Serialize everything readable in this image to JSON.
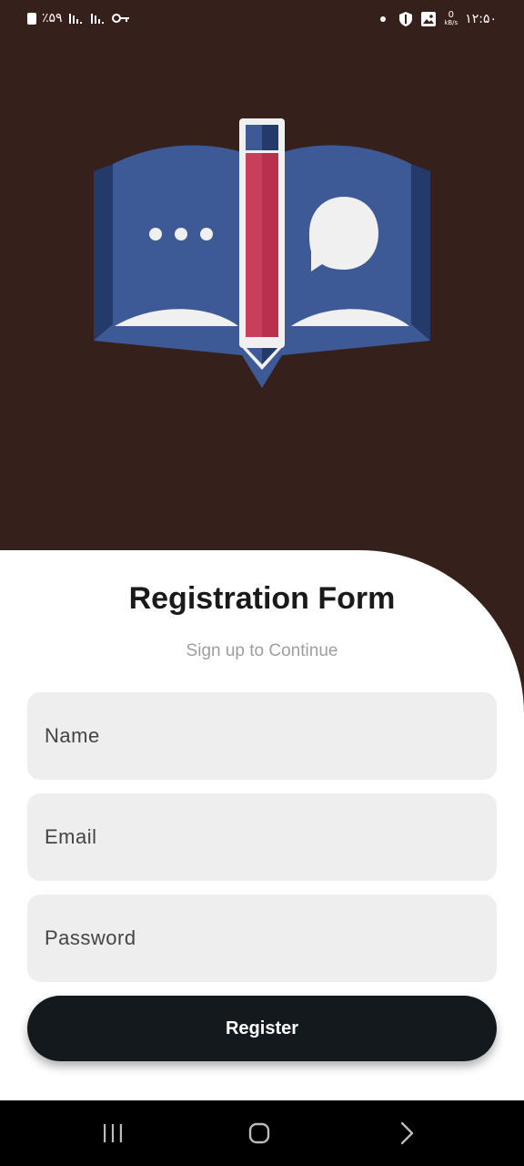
{
  "status_bar": {
    "battery": "٪۵۹",
    "time": "۱۲:۵۰",
    "net_speed": "0",
    "net_unit": "kB/s"
  },
  "form": {
    "title": "Registration Form",
    "subtitle": "Sign up to Continue",
    "name_placeholder": "Name",
    "email_placeholder": "Email",
    "password_placeholder": "Password",
    "register_label": "Register"
  },
  "colors": {
    "header_background": "#36201b",
    "book_blue": "#3e5a96",
    "book_dark": "#243a6a",
    "pencil_red": "#c93e5a",
    "button": "#13191c",
    "field": "#eeeeee"
  }
}
